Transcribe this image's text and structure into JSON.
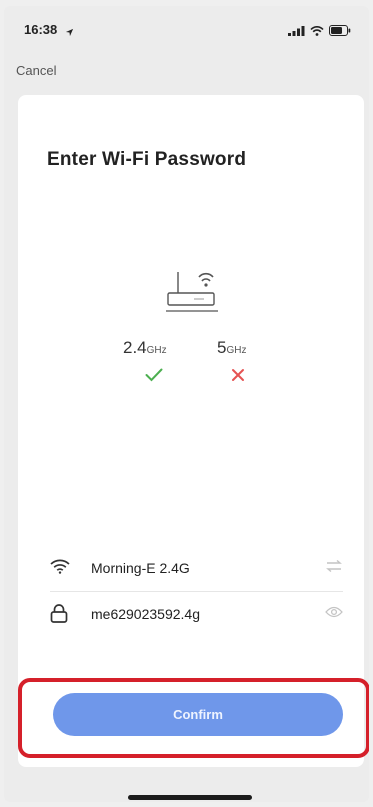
{
  "status": {
    "time": "16:38",
    "icons": [
      "location-arrow-icon",
      "signal-icon",
      "wifi-icon",
      "battery-icon"
    ]
  },
  "nav": {
    "cancel_label": "Cancel"
  },
  "page": {
    "title": "Enter Wi-Fi Password"
  },
  "bands": [
    {
      "value": "2.4",
      "unit": "GHz",
      "supported": true
    },
    {
      "value": "5",
      "unit": "GHz",
      "supported": false
    }
  ],
  "form": {
    "ssid": "Morning-E 2.4G",
    "password": "me629023592.4g"
  },
  "actions": {
    "confirm_label": "Confirm"
  },
  "colors": {
    "accent": "#6f97ea",
    "success": "#4caf50",
    "error": "#e55353",
    "highlight": "#d5202a"
  }
}
